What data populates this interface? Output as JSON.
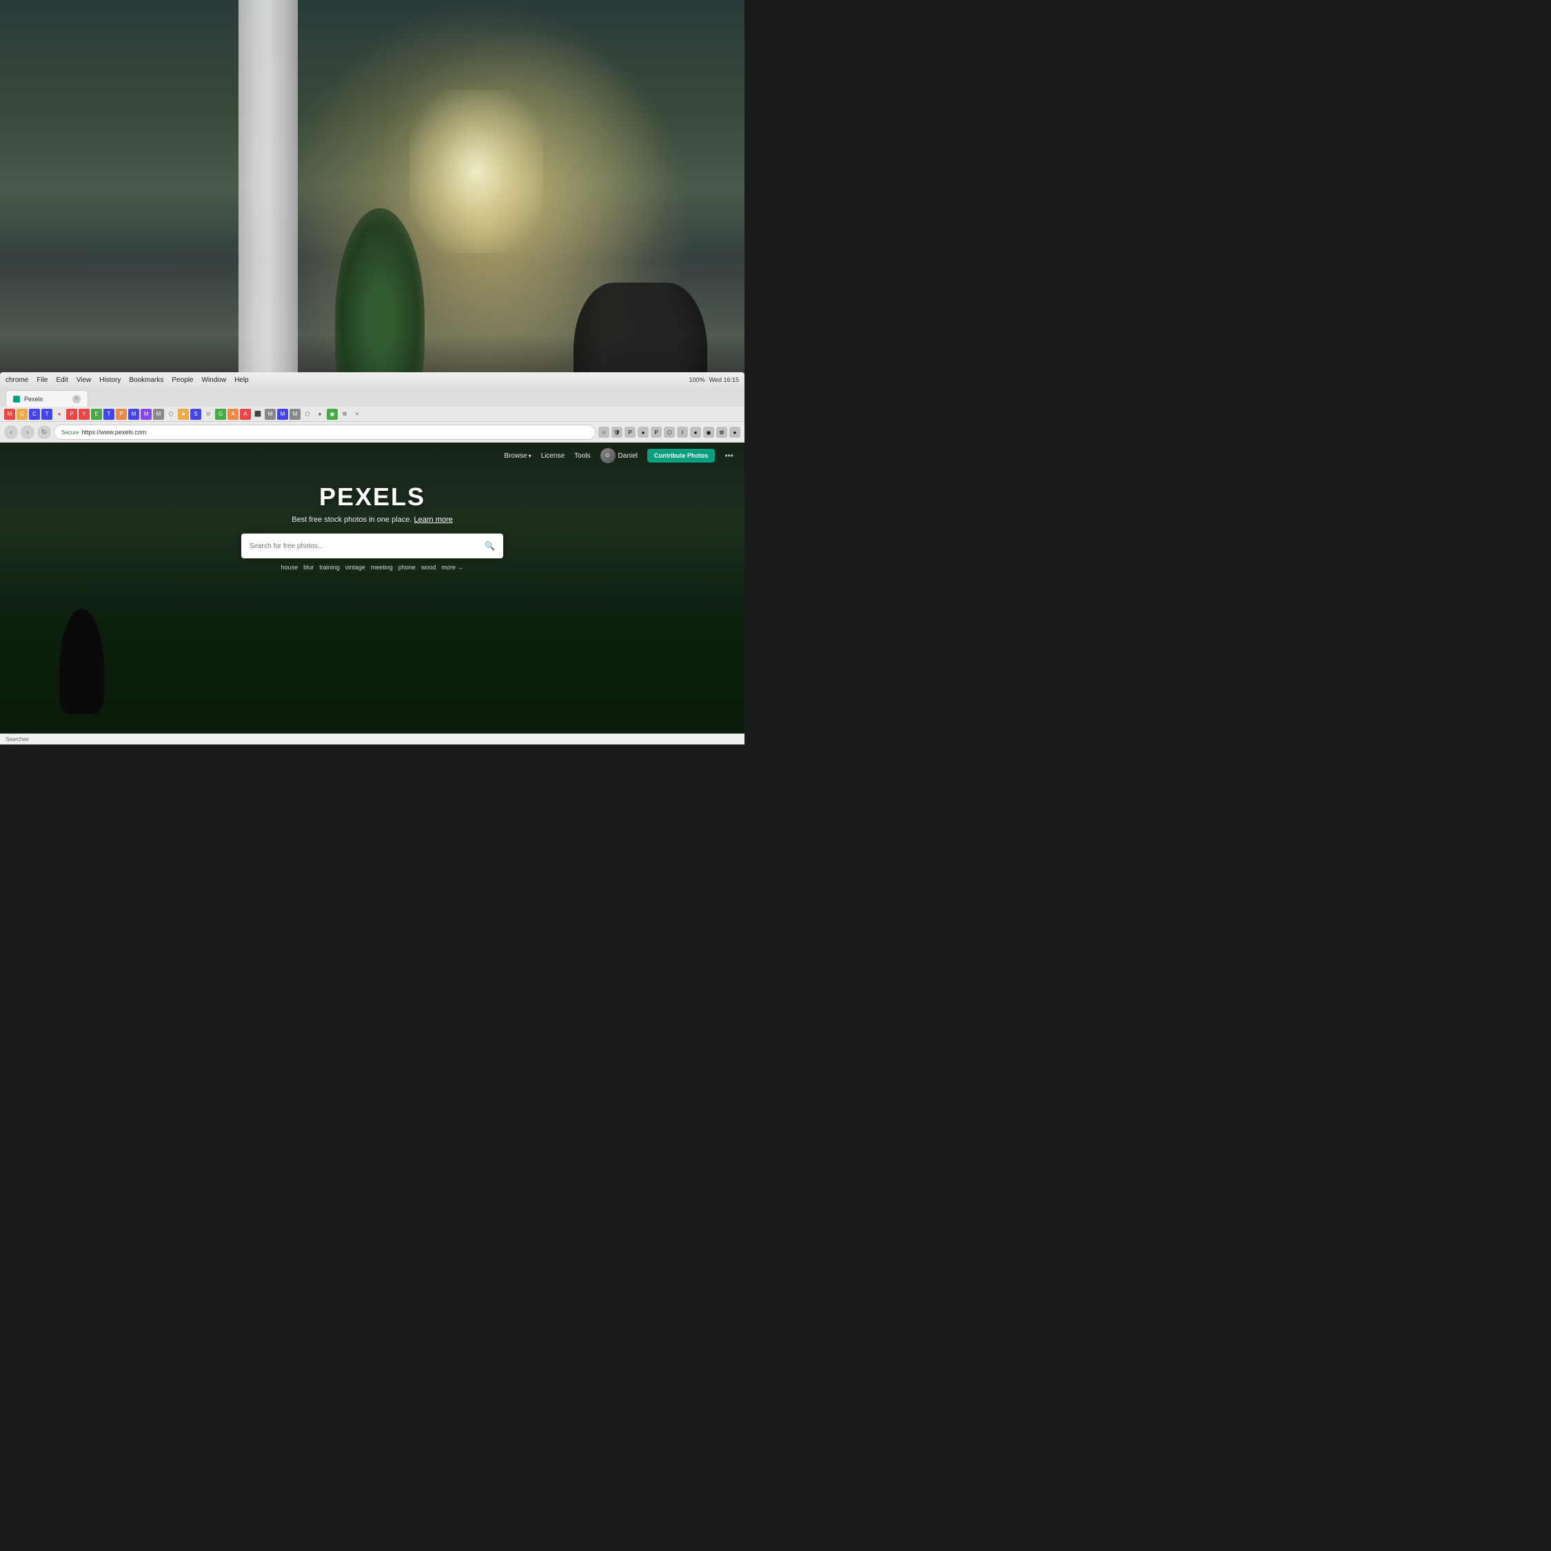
{
  "background": {
    "alt": "Office workspace background with blurred bokeh"
  },
  "os_bar": {
    "app_name": "chrome",
    "menus": [
      "File",
      "Edit",
      "View",
      "History",
      "Bookmarks",
      "People",
      "Window",
      "Help"
    ],
    "time": "Wed 16:15",
    "battery": "100%"
  },
  "browser": {
    "tab": {
      "label": "Pexels",
      "favicon_color": "#05a081"
    },
    "address": {
      "secure_label": "Secure",
      "url": "https://www.pexels.com"
    },
    "close_icon": "×"
  },
  "website": {
    "nav": {
      "browse_label": "Browse",
      "license_label": "License",
      "tools_label": "Tools",
      "user_label": "Daniel",
      "contribute_label": "Contribute Photos",
      "more_icon": "•••"
    },
    "hero": {
      "title": "PEXELS",
      "tagline": "Best free stock photos in one place.",
      "tagline_link": "Learn more",
      "search_placeholder": "Search for free photos...",
      "search_tags": [
        "house",
        "blur",
        "training",
        "vintage",
        "meeting",
        "phone",
        "wood",
        "more →"
      ]
    }
  },
  "status_bar": {
    "text": "Searches"
  },
  "colors": {
    "contribute_btn": "#05a081",
    "nav_bg": "transparent",
    "hero_dark": "#0a1a0a"
  }
}
